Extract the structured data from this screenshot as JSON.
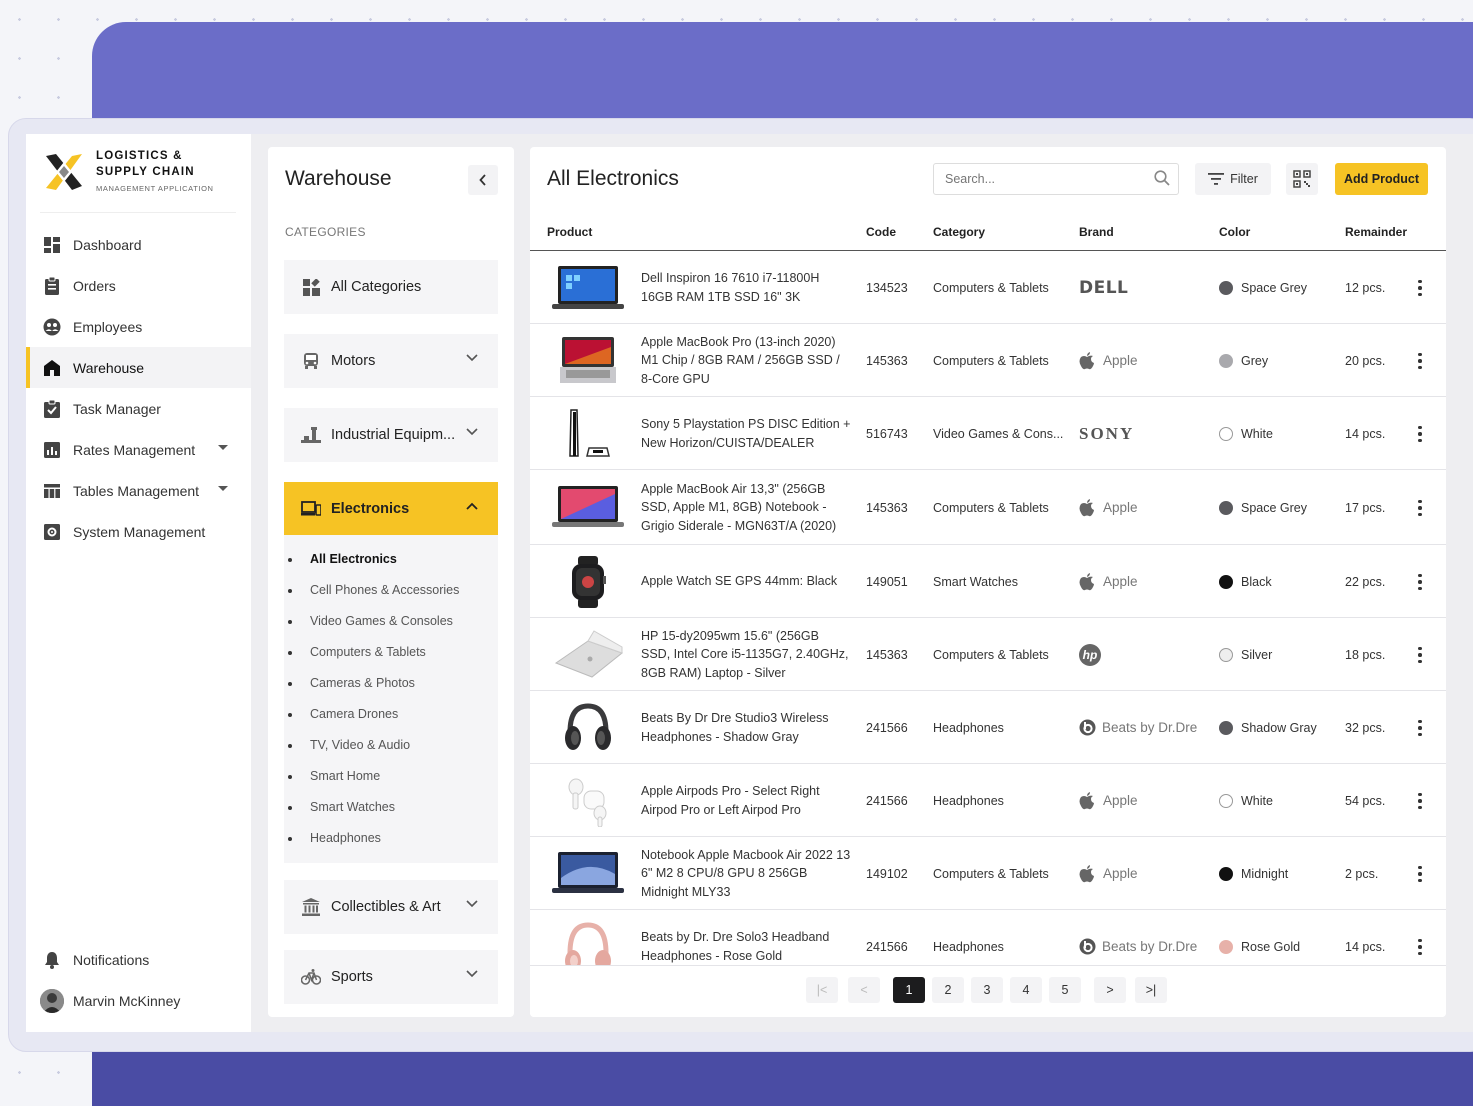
{
  "app": {
    "logo_line1": "LOGISTICS &",
    "logo_line2": "SUPPLY CHAIN",
    "logo_sub": "MANAGEMENT APPLICATION"
  },
  "sidebar": {
    "items": [
      {
        "label": "Dashboard",
        "icon": "dashboard-icon"
      },
      {
        "label": "Orders",
        "icon": "clipboard-icon"
      },
      {
        "label": "Employees",
        "icon": "people-icon"
      },
      {
        "label": "Warehouse",
        "icon": "home-icon",
        "active": true
      },
      {
        "label": "Task Manager",
        "icon": "task-check-icon"
      },
      {
        "label": "Rates Management",
        "icon": "chart-icon",
        "expandable": true
      },
      {
        "label": "Tables Management",
        "icon": "table-icon",
        "expandable": true
      },
      {
        "label": "System Management",
        "icon": "gear-icon"
      }
    ],
    "notifications": "Notifications",
    "user_name": "Marvin McKinney"
  },
  "categories_panel": {
    "title": "Warehouse",
    "section_label": "CATEGORIES",
    "items": [
      {
        "label": "All Categories",
        "icon": "grid-icon"
      },
      {
        "label": "Motors",
        "icon": "car-icon"
      },
      {
        "label": "Industrial Equipm...",
        "icon": "industrial-icon"
      },
      {
        "label": "Electronics",
        "icon": "devices-icon",
        "open": true
      },
      {
        "label": "Collectibles & Art",
        "icon": "museum-icon"
      },
      {
        "label": "Sports",
        "icon": "bike-icon"
      }
    ],
    "electronics_sub": [
      "All Electronics",
      "Cell Phones & Accessories",
      "Video Games & Consoles",
      "Computers & Tablets",
      "Cameras & Photos",
      "Camera Drones",
      "TV, Video & Audio",
      "Smart Home",
      "Smart Watches",
      "Headphones"
    ]
  },
  "main": {
    "title": "All Electronics",
    "search_placeholder": "Search...",
    "filter_label": "Filter",
    "add_label": "Add Product",
    "columns": [
      "Product",
      "Code",
      "Category",
      "Brand",
      "Color",
      "Remainder"
    ],
    "rows": [
      {
        "name": "Dell Inspiron 16 7610 i7-11800H 16GB RAM 1TB SSD 16\" 3K",
        "code": "134523",
        "category": "Computers & Tablets",
        "brand": "DELL",
        "brand_style": "dell",
        "color": "Space Grey",
        "swatch": "#5a5a5e",
        "remainder": "12 pcs."
      },
      {
        "name": "Apple MacBook Pro (13-inch 2020) M1 Chip / 8GB RAM / 256GB SSD / 8-Core GPU",
        "code": "145363",
        "category": "Computers & Tablets",
        "brand": "Apple",
        "brand_style": "apple",
        "color": "Grey",
        "swatch": "#a9a9ad",
        "remainder": "20 pcs."
      },
      {
        "name": "Sony 5 Playstation PS DISC Edition + New Horizon/CUISTA/DEALER",
        "code": "516743",
        "category": "Video Games & Cons...",
        "brand": "SONY",
        "brand_style": "sony",
        "color": "White",
        "swatch": "#ffffff",
        "remainder": "14 pcs."
      },
      {
        "name": "Apple MacBook Air 13,3\" (256GB SSD, Apple M1, 8GB) Notebook - Grigio Siderale - MGN63T/A (2020)",
        "code": "145363",
        "category": "Computers & Tablets",
        "brand": "Apple",
        "brand_style": "apple",
        "color": "Space Grey",
        "swatch": "#5a5a5e",
        "remainder": "17 pcs."
      },
      {
        "name": "Apple Watch SE GPS 44mm: Black",
        "code": "149051",
        "category": "Smart Watches",
        "brand": "Apple",
        "brand_style": "apple",
        "color": "Black",
        "swatch": "#111111",
        "remainder": "22 pcs."
      },
      {
        "name": "HP 15-dy2095wm 15.6\" (256GB SSD, Intel Core i5-1135G7, 2.40GHz, 8GB RAM) Laptop - Silver",
        "code": "145363",
        "category": "Computers & Tablets",
        "brand": "hp",
        "brand_style": "hp",
        "color": "Silver",
        "swatch": "#eeeeee",
        "remainder": "18 pcs."
      },
      {
        "name": "Beats By Dr Dre Studio3 Wireless Headphones - Shadow Gray",
        "code": "241566",
        "category": "Headphones",
        "brand": "Beats by Dr.Dre",
        "brand_style": "beats",
        "color": "Shadow Gray",
        "swatch": "#5a5a5e",
        "remainder": "32 pcs."
      },
      {
        "name": "Apple Airpods Pro - Select Right Airpod Pro or Left Airpod Pro",
        "code": "241566",
        "category": "Headphones",
        "brand": "Apple",
        "brand_style": "apple",
        "color": "White",
        "swatch": "#ffffff",
        "remainder": "54 pcs."
      },
      {
        "name": "Notebook Apple Macbook Air 2022 13 6\" M2 8 CPU/8 GPU 8 256GB Midnight MLY33",
        "code": "149102",
        "category": "Computers & Tablets",
        "brand": "Apple",
        "brand_style": "apple",
        "color": "Midnight",
        "swatch": "#111111",
        "remainder": "2 pcs."
      },
      {
        "name": "Beats by Dr. Dre Solo3 Headband Headphones - Rose Gold",
        "code": "241566",
        "category": "Headphones",
        "brand": "Beats by Dr.Dre",
        "brand_style": "beats",
        "color": "Rose Gold",
        "swatch": "#e7b1a9",
        "remainder": "14 pcs."
      }
    ],
    "pagination": {
      "pages": [
        "1",
        "2",
        "3",
        "4",
        "5"
      ],
      "current": "1",
      "first": "|<",
      "prev": "<",
      "next": ">",
      "last": ">|"
    }
  }
}
